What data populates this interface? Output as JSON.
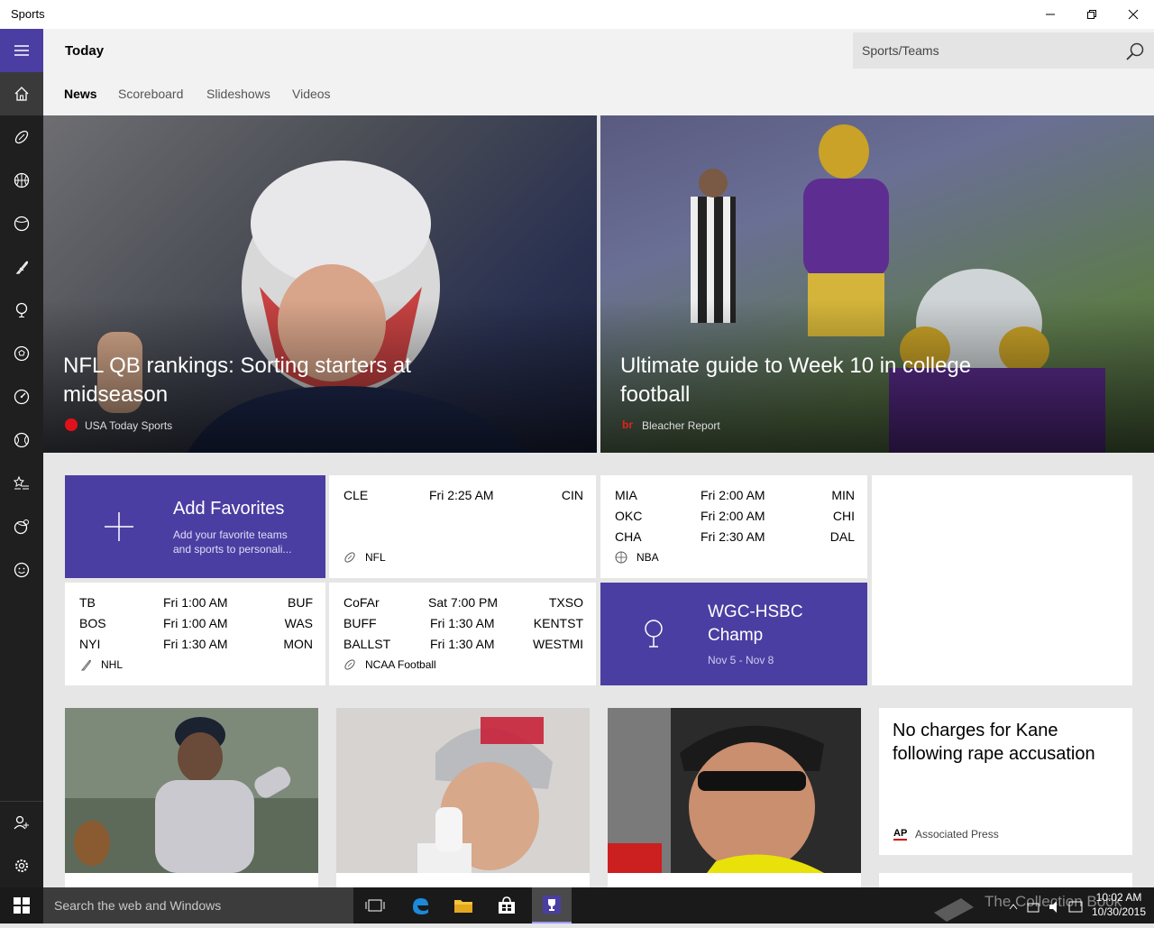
{
  "window": {
    "title": "Sports"
  },
  "header": {
    "title": "Today",
    "search_placeholder": "Sports/Teams"
  },
  "tabs": [
    {
      "label": "News"
    },
    {
      "label": "Scoreboard"
    },
    {
      "label": "Slideshows"
    },
    {
      "label": "Videos"
    }
  ],
  "hero": [
    {
      "title": "NFL QB rankings: Sorting starters at midseason",
      "source": "USA Today Sports"
    },
    {
      "title": "Ultimate guide to Week 10 in college football",
      "source": "Bleacher Report",
      "source_logo": "br"
    }
  ],
  "favorites": {
    "title": "Add Favorites",
    "desc": "Add your favorite teams and sports to personali..."
  },
  "scores": {
    "nfl": {
      "league": "NFL",
      "games": [
        {
          "home": "CLE",
          "time": "Fri 2:25 AM",
          "away": "CIN"
        }
      ]
    },
    "nba": {
      "league": "NBA",
      "games": [
        {
          "home": "MIA",
          "time": "Fri 2:00 AM",
          "away": "MIN"
        },
        {
          "home": "OKC",
          "time": "Fri 2:00 AM",
          "away": "CHI"
        },
        {
          "home": "CHA",
          "time": "Fri 2:30 AM",
          "away": "DAL"
        }
      ]
    },
    "nhl": {
      "league": "NHL",
      "games": [
        {
          "home": "TB",
          "time": "Fri 1:00 AM",
          "away": "BUF"
        },
        {
          "home": "BOS",
          "time": "Fri 1:00 AM",
          "away": "WAS"
        },
        {
          "home": "NYI",
          "time": "Fri 1:30 AM",
          "away": "MON"
        }
      ]
    },
    "ncaa": {
      "league": "NCAA Football",
      "games": [
        {
          "home": "CoFAr",
          "time": "Sat 7:00 PM",
          "away": "TXSO"
        },
        {
          "home": "BUFF",
          "time": "Fri 1:30 AM",
          "away": "KENTST"
        },
        {
          "home": "BALLST",
          "time": "Fri 1:30 AM",
          "away": "WESTMI"
        }
      ]
    }
  },
  "golf": {
    "title": "WGC-HSBC Champ",
    "dates": "Nov 5 - Nov 8"
  },
  "news_card": {
    "title": "No charges for Kane following rape accusation",
    "source": "Associated Press",
    "source_logo": "AP"
  },
  "taskbar": {
    "search": "Search the web and Windows",
    "time": "10:02 AM",
    "date": "10/30/2015",
    "watermark": "The Collection Book"
  },
  "colors": {
    "accent": "#4b3ea2",
    "sidebar": "#1f1f1f",
    "header": "#f2f2f2"
  }
}
